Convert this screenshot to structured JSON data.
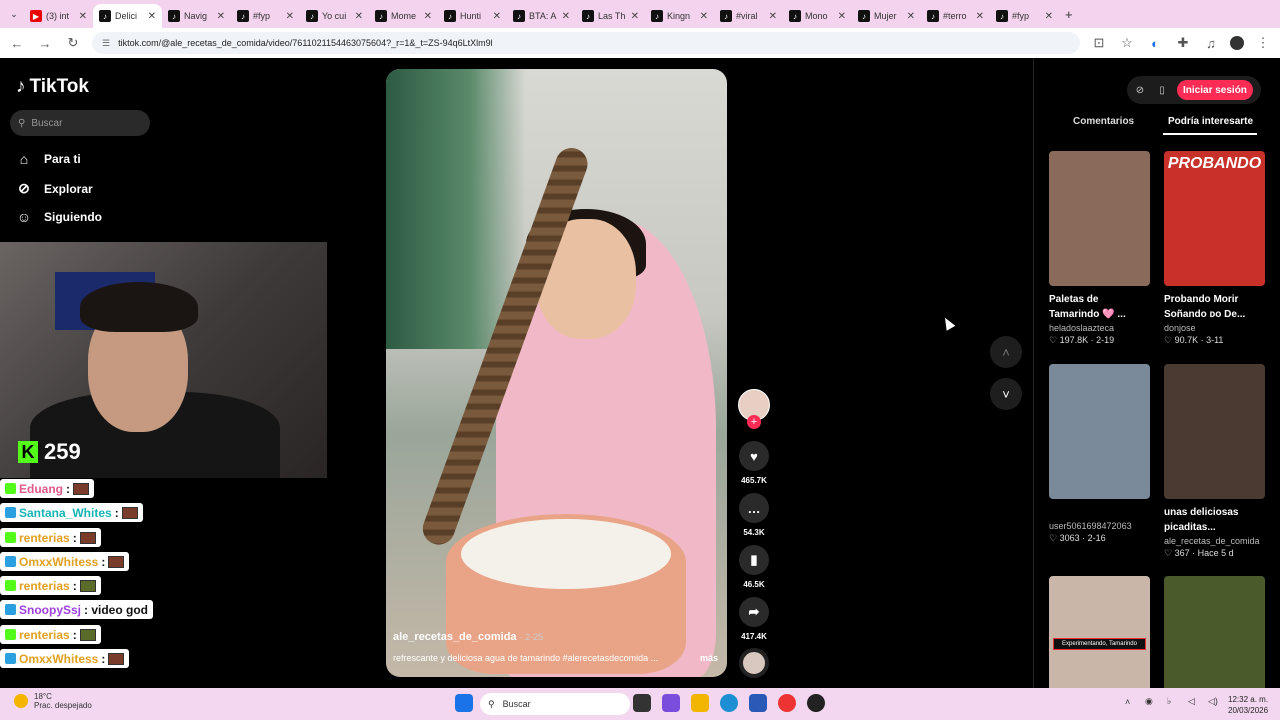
{
  "browser": {
    "tabs": [
      {
        "label": "(3) int",
        "icon": "youtube-icon"
      },
      {
        "label": "Delici",
        "icon": "tiktok-icon",
        "active": true
      },
      {
        "label": "Navig",
        "icon": "tiktok-icon"
      },
      {
        "label": "#fyp",
        "icon": "tiktok-icon"
      },
      {
        "label": "Yo cui",
        "icon": "tiktok-icon"
      },
      {
        "label": "Mome",
        "icon": "tiktok-icon"
      },
      {
        "label": "Hunti",
        "icon": "tiktok-icon"
      },
      {
        "label": "BTA: A",
        "icon": "tiktok-icon"
      },
      {
        "label": "Las Th",
        "icon": "tiktok-icon"
      },
      {
        "label": "Kingn",
        "icon": "tiktok-icon"
      },
      {
        "label": "#viral",
        "icon": "tiktok-icon"
      },
      {
        "label": "Mono",
        "icon": "tiktok-icon"
      },
      {
        "label": "Mujer",
        "icon": "tiktok-icon"
      },
      {
        "label": "#terro",
        "icon": "tiktok-icon"
      },
      {
        "label": "#fyp",
        "icon": "tiktok-icon"
      }
    ],
    "url": "tiktok.com/@ale_recetas_de_comida/video/7611021154463075604?_r=1&_t=ZS-94q6LtXlm9l"
  },
  "sidebar": {
    "logo": "TikTok",
    "search_placeholder": "Buscar",
    "items": [
      {
        "label": "Para ti",
        "icon": "home-icon"
      },
      {
        "label": "Explorar",
        "icon": "compass-icon"
      },
      {
        "label": "Siguiendo",
        "icon": "user-icon"
      }
    ]
  },
  "stream": {
    "viewer_count": "259",
    "chat": [
      {
        "user": "Eduang",
        "color": "#e05a8a",
        "msg": ":",
        "emote": "brick"
      },
      {
        "user": "Santana_Whites",
        "color": "#17b4b4",
        "msg": ":",
        "emote": "brick"
      },
      {
        "user": "renterias",
        "color": "#e0a020",
        "msg": ":",
        "emote": "brick"
      },
      {
        "user": "OmxxWhitess",
        "color": "#e0a020",
        "msg": ":",
        "emote": "brick"
      },
      {
        "user": "renterias",
        "color": "#e0a020",
        "msg": ":",
        "emote": "turtle"
      },
      {
        "user": "SnoopySsj",
        "color": "#a040e0",
        "msg": ": video god",
        "emote": ""
      },
      {
        "user": "renterias",
        "color": "#e0a020",
        "msg": ":",
        "emote": "turtle"
      },
      {
        "user": "OmxxWhitess",
        "color": "#e0a020",
        "msg": ":",
        "emote": "brick"
      }
    ]
  },
  "video": {
    "author": "ale_recetas_de_comida",
    "date": "· 2-25",
    "caption": "refrescante y deliciosa agua de tamarindo #alerecetasdecomida ...",
    "more": "más",
    "likes": "465.7K",
    "comments": "54.3K",
    "saves": "46.5K",
    "shares": "417.4K"
  },
  "panel": {
    "login": "Iniciar sesión",
    "tabs": [
      "Comentarios",
      "Podría interesarte"
    ],
    "cards": [
      {
        "title": "Paletas de Tamarindo 🩷 ...",
        "user": "heladoslaazteca",
        "likes": "♡ 197.8K · 2-19",
        "thumb": "#8a6a5a",
        "label": ""
      },
      {
        "title": "Probando Morir Soñando ᴅᴏ De...",
        "user": "donjose",
        "likes": "♡ 90.7K · 3-11",
        "thumb": "#c8302a",
        "label": "PROBANDO"
      },
      {
        "title": "",
        "user": "user5061698472063",
        "likes": "♡ 3063 · 2-16",
        "thumb": "#7a8a9a",
        "label": ""
      },
      {
        "title": "unas deliciosas picaditas...",
        "user": "ale_recetas_de_comida",
        "likes": "♡ 367 · Hace 5 d",
        "thumb": "#4a3a32",
        "label": ""
      },
      {
        "title": "",
        "user": "",
        "likes": "",
        "thumb": "#c9b6a8",
        "label": "Experimentando, Tamarindo"
      },
      {
        "title": "",
        "user": "",
        "likes": "",
        "thumb": "#4a5a2a",
        "label": ""
      }
    ]
  },
  "taskbar": {
    "weather_temp": "18°C",
    "weather_desc": "Prac. despejado",
    "search": "Buscar",
    "time": "12:32 a. m.",
    "date": "20/03/2026"
  }
}
